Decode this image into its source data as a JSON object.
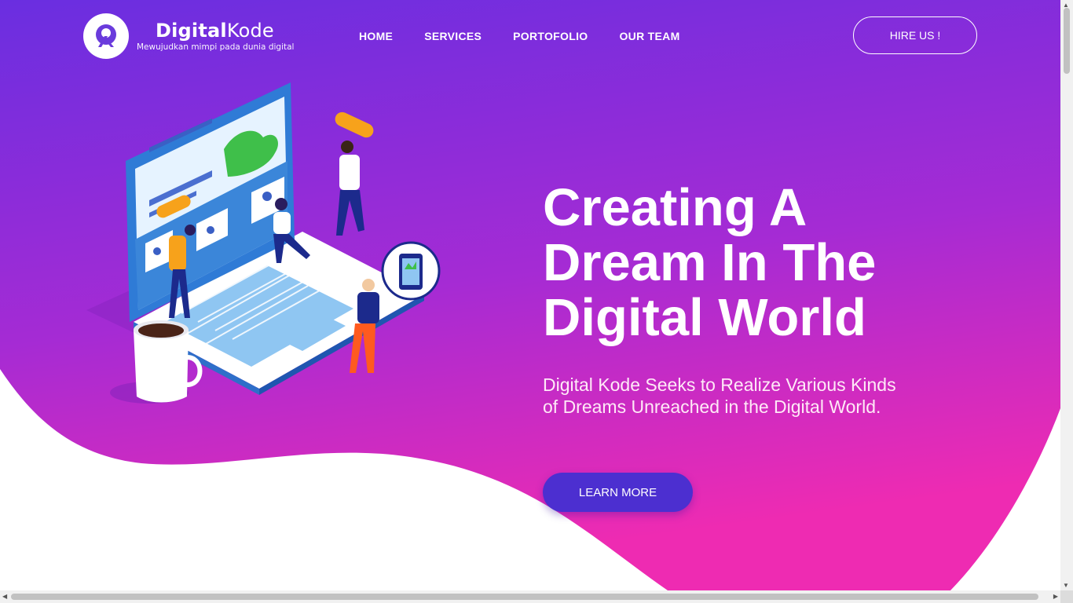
{
  "brand": {
    "name_bold": "Digital",
    "name_regular": "Kode",
    "tagline": "Mewujudkan mimpi pada dunia digital",
    "logo_icon": "digitalkode-logo-icon"
  },
  "nav": {
    "items": [
      {
        "label": "HOME"
      },
      {
        "label": "SERVICES"
      },
      {
        "label": "PORTOFOLIO"
      },
      {
        "label": "OUR TEAM"
      }
    ],
    "hire_label": "HIRE US !"
  },
  "hero": {
    "headline": "Creating A Dream In The Digital World",
    "subtext": "Digital Kode Seeks to Realize Various Kinds of Dreams Unreached in the Digital World.",
    "cta_label": "LEARN MORE",
    "illustration": "isometric-laptop-team-illustration"
  },
  "colors": {
    "gradient_top": "#6a2ee0",
    "gradient_bottom": "#ee2bb2",
    "cta": "#4c2fd0",
    "background": "#ffffff"
  }
}
